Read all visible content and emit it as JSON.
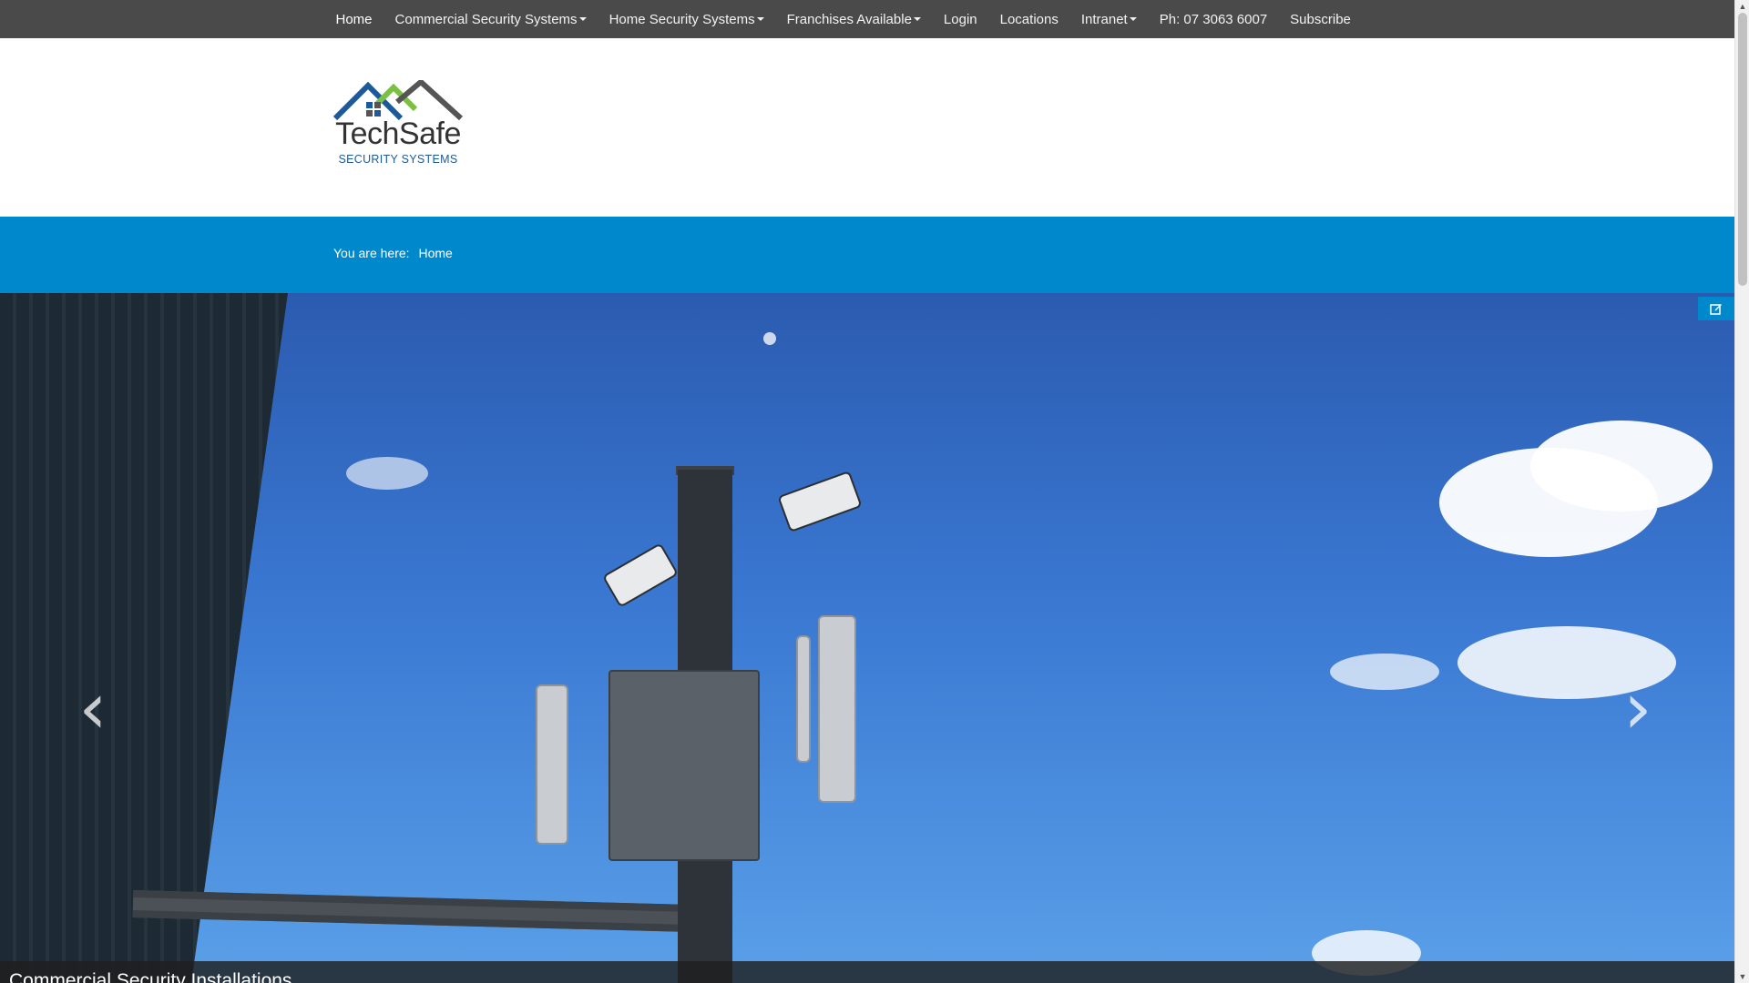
{
  "nav": {
    "items": [
      {
        "label": "Home",
        "dropdown": false,
        "active": true
      },
      {
        "label": "Commercial Security Systems",
        "dropdown": true
      },
      {
        "label": "Home Security Systems",
        "dropdown": true
      },
      {
        "label": "Franchises Available",
        "dropdown": true
      },
      {
        "label": "Login",
        "dropdown": false
      },
      {
        "label": "Locations",
        "dropdown": false
      },
      {
        "label": "Intranet",
        "dropdown": true
      },
      {
        "label": "Ph: 07 3063 6007",
        "dropdown": false
      },
      {
        "label": "Subscribe",
        "dropdown": false
      }
    ]
  },
  "logo": {
    "name": "TechSafe",
    "tagline": "SECURITY SYSTEMS",
    "roof_colors": [
      "#1d5a9c",
      "#7ac143",
      "#555555"
    ]
  },
  "breadcrumb": {
    "prefix": "You are here:",
    "current": "Home"
  },
  "slider": {
    "caption": "Commercial Security Installations",
    "prev_icon": "chevron-left-icon",
    "next_icon": "chevron-right-icon",
    "edit_icon": "edit-icon"
  },
  "colors": {
    "nav_bg": "#4a4a4a",
    "band_bg": "#0088cc"
  }
}
